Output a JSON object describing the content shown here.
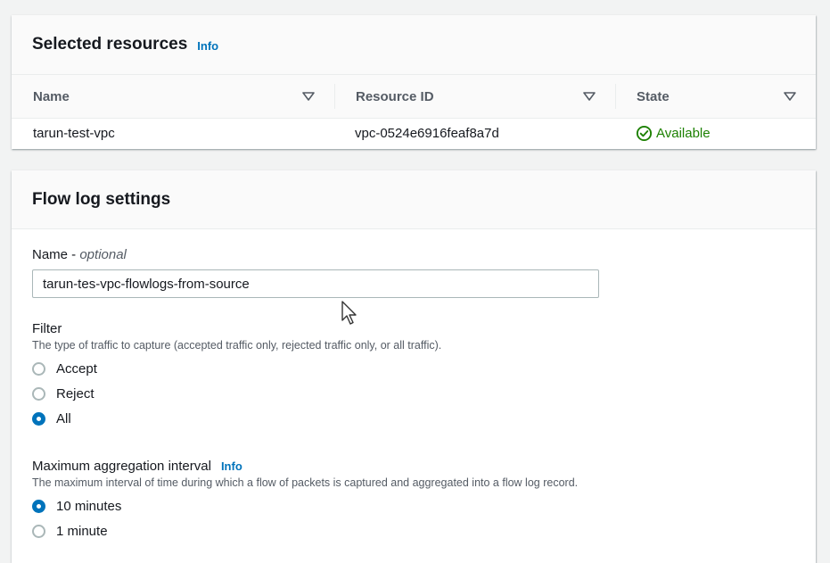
{
  "selected_resources": {
    "title": "Selected resources",
    "info_label": "Info",
    "columns": [
      "Name",
      "Resource ID",
      "State"
    ],
    "rows": [
      {
        "name": "tarun-test-vpc",
        "resource_id": "vpc-0524e6916feaf8a7d",
        "state": "Available"
      }
    ]
  },
  "flow_log_settings": {
    "title": "Flow log settings",
    "name_field": {
      "label": "Name - ",
      "optional_label": "optional",
      "value": "tarun-tes-vpc-flowlogs-from-source"
    },
    "filter": {
      "label": "Filter",
      "description": "The type of traffic to capture (accepted traffic only, rejected traffic only, or all traffic).",
      "options": [
        "Accept",
        "Reject",
        "All"
      ],
      "selected": "All"
    },
    "aggregation": {
      "label": "Maximum aggregation interval",
      "info_label": "Info",
      "description": "The maximum interval of time during which a flow of packets is captured and aggregated into a flow log record.",
      "options": [
        "10 minutes",
        "1 minute"
      ],
      "selected": "10 minutes"
    }
  },
  "colors": {
    "link": "#0073bb",
    "success": "#1d8102",
    "radio_selected": "#0073bb"
  }
}
